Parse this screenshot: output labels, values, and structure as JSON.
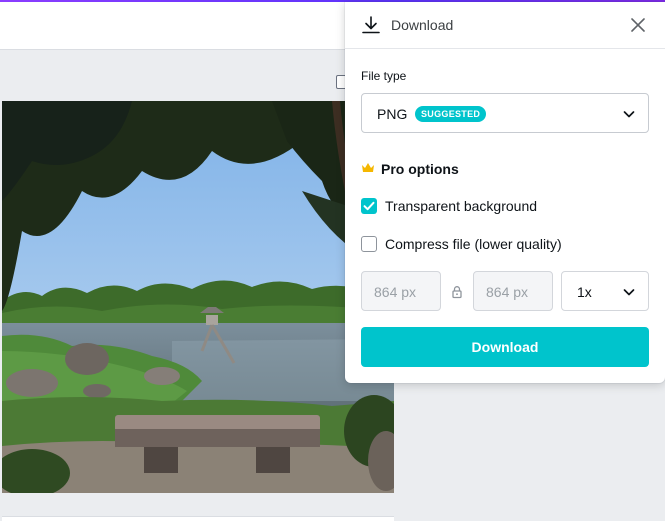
{
  "panel": {
    "title": "Download",
    "header_icon": "download-icon",
    "close_icon": "close-icon"
  },
  "file_type": {
    "label": "File type",
    "value": "PNG",
    "badge": "SUGGESTED",
    "chevron_icon": "chevron-down-icon"
  },
  "pro_options": {
    "title": "Pro options",
    "icon": "crown-icon",
    "transparent_background": {
      "label": "Transparent background",
      "checked": true
    },
    "compress_file": {
      "label": "Compress file (lower quality)",
      "checked": false
    }
  },
  "size": {
    "width": "864 px",
    "height": "864 px",
    "lock_icon": "lock-icon",
    "scale": "1x"
  },
  "download_button": {
    "label": "Download"
  },
  "colors": {
    "accent": "#00c4cc",
    "top_accent": "#7d2ae8",
    "crown": "#f5b700"
  }
}
